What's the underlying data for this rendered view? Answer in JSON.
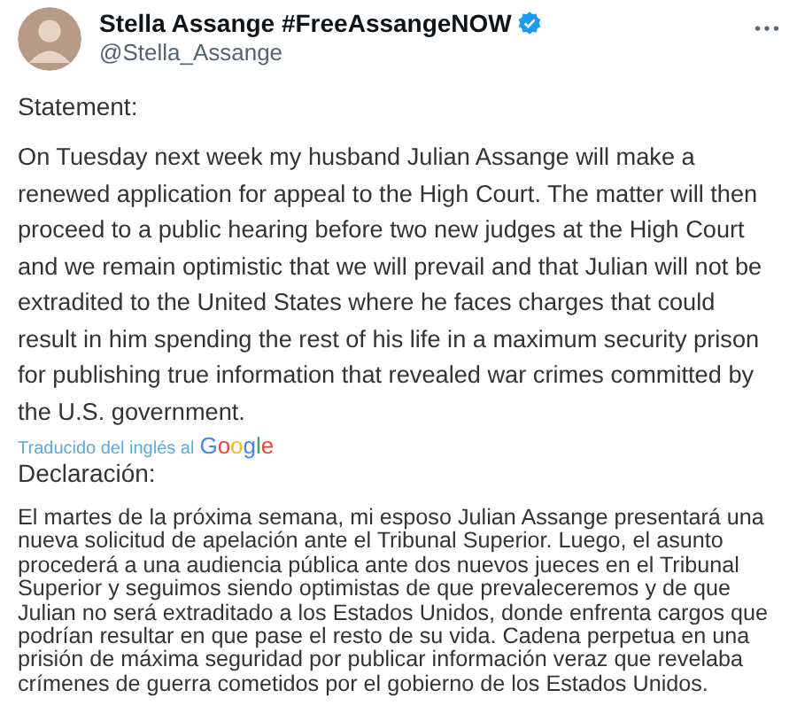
{
  "author": {
    "name": "Stella Assange #FreeAssangeNOW",
    "handle": "@Stella_Assange",
    "verified": true
  },
  "original": {
    "heading": "Statement:",
    "body": "On Tuesday next week my husband Julian Assange will make a renewed application for appeal to the High Court. The matter will then proceed to a public hearing before two new judges at the High Court and we remain optimistic that we will prevail and that Julian will not be extradited to the United States where he faces charges that could result in him spending the rest of his life in a maximum security prison for publishing true information that revealed war crimes committed by the U.S. government."
  },
  "translation_note": {
    "label": "Traducido del inglés al",
    "provider": "Google"
  },
  "translation": {
    "heading": "Declaración:",
    "body": "El martes de la próxima semana, mi esposo Julian Assange presentará una nueva solicitud de apelación ante el Tribunal Superior. Luego, el asunto procederá a una audiencia pública ante dos nuevos jueces en el Tribunal Superior y seguimos siendo optimistas de que prevaleceremos y de que Julian no será extraditado a los Estados Unidos, donde enfrenta cargos que podrían resultar en que pase el resto de su vida. Cadena perpetua en una prisión de máxima seguridad por publicar información veraz que revelaba crímenes de guerra cometidos por el gobierno de los Estados Unidos."
  }
}
